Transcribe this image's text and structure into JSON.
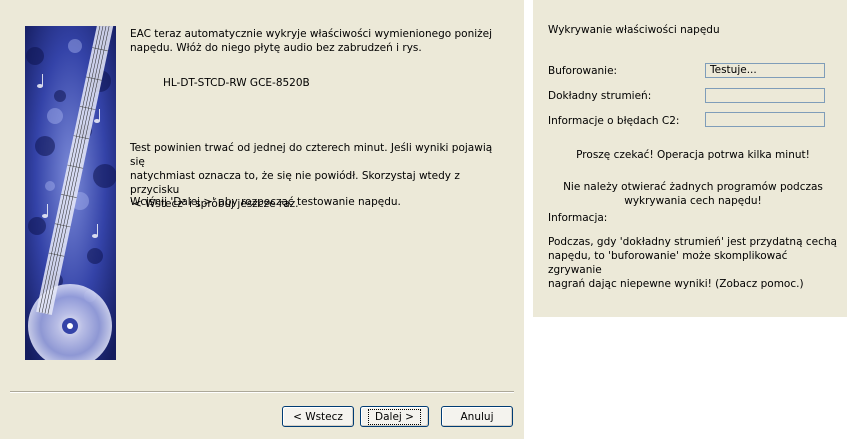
{
  "wizard": {
    "intro_text": "EAC teraz automatycznie wykryje właściwości wymienionego poniżej\nnapędu. Włóż do niego płytę audio bez zabrudzeń i rys.",
    "drive_name": "HL-DT-STCD-RW GCE-8520B",
    "test_text": "Test powinien trwać od jednej do czterech minut. Jeśli wyniki pojawią się\nnatychmiast oznacza to, że się nie powiódł. Skorzystaj wtedy z przycisku\n'< Wstecz' i spróbuj jeszcze raz.",
    "next_instruction": "Wciśnij 'Dalej >' aby rozpocząć testowanie napędu.",
    "buttons": {
      "back": "< Wstecz",
      "next": "Dalej >",
      "cancel": "Anuluj"
    }
  },
  "panel": {
    "title": "Wykrywanie właściwości napędu",
    "fields": [
      {
        "label": "Buforowanie:",
        "value": "Testuje..."
      },
      {
        "label": "Dokładny strumień:",
        "value": ""
      },
      {
        "label": "Informacje o błędach C2:",
        "value": ""
      }
    ],
    "wait_message": "Proszę czekać! Operacja potrwa kilka minut!",
    "warning_message": "Nie należy otwierać żadnych programów podczas\nwykrywania cech napędu!",
    "info_label": "Informacja:",
    "info_text": "Podczas, gdy 'dokładny strumień' jest przydatną cechą\nnapędu, to 'buforowanie' może skomplikować zgrywanie\nnagrań dając niepewne wyniki! (Zobacz pomoc.)"
  },
  "colors": {
    "dialog_bg": "#ECE9D8",
    "art_blue": "#2E3C9A",
    "button_border": "#003C74",
    "field_border": "#7F9DB9"
  },
  "icons": {
    "art": "guitar-cd-artwork"
  }
}
